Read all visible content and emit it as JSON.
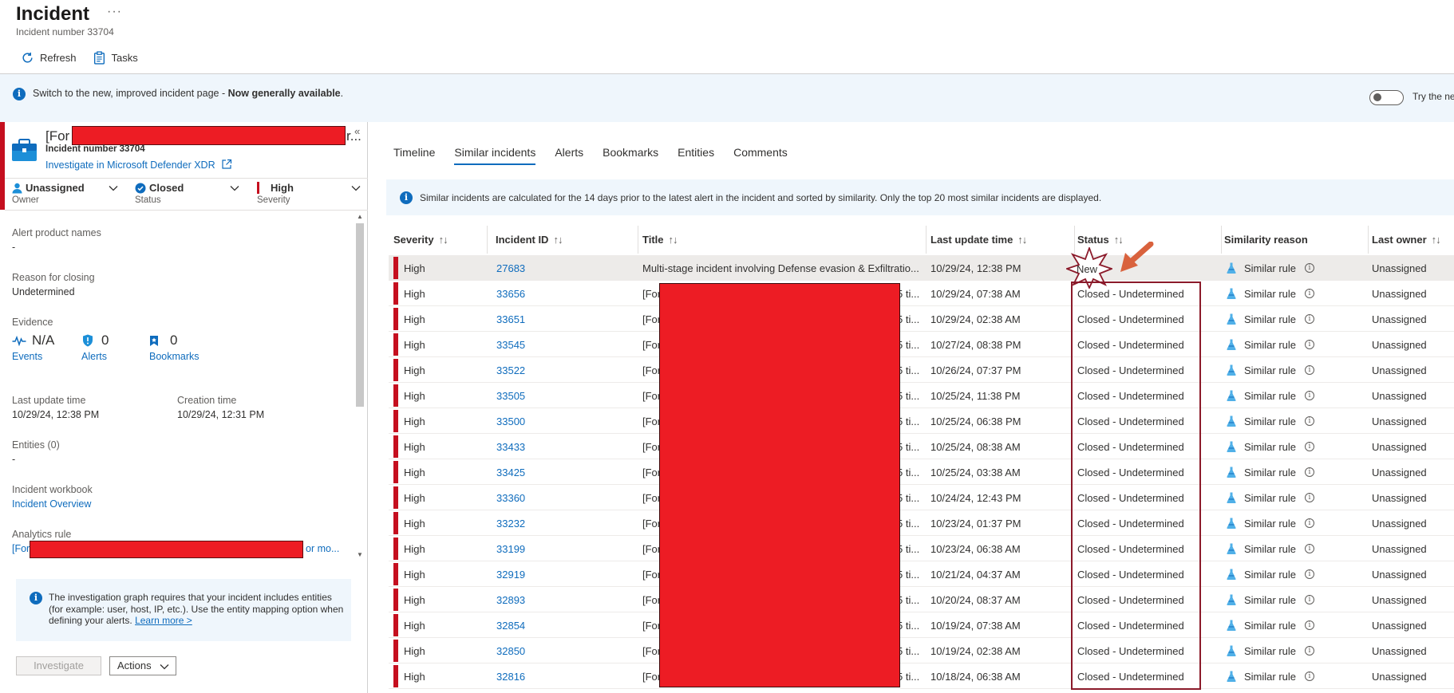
{
  "header": {
    "title": "Incident",
    "more": "···",
    "subtitle": "Incident number 33704"
  },
  "toolbar": {
    "refresh_label": "Refresh",
    "tasks_label": "Tasks"
  },
  "banner": {
    "text_plain": "Switch to the new, improved incident page - ",
    "text_bold": "Now generally available",
    "text_end": ".",
    "toggle_label": "Try the ne"
  },
  "left_panel": {
    "collapse": "«",
    "title_prefix": "[For",
    "title_suffix": "r...",
    "incident_number": "Incident number 33704",
    "investigate_link": "Investigate in Microsoft Defender XDR",
    "owner": {
      "value": "Unassigned",
      "label": "Owner"
    },
    "status": {
      "value": "Closed",
      "label": "Status"
    },
    "severity": {
      "value": "High",
      "label": "Severity"
    },
    "alert_product_names": {
      "label": "Alert product names",
      "value": "-"
    },
    "reason_for_closing": {
      "label": "Reason for closing",
      "value": "Undetermined"
    },
    "evidence": {
      "label": "Evidence",
      "events": {
        "num": "N/A",
        "label": "Events"
      },
      "alerts": {
        "num": "0",
        "label": "Alerts"
      },
      "bookmarks": {
        "num": "0",
        "label": "Bookmarks"
      }
    },
    "last_update_time": {
      "label": "Last update time",
      "value": "10/29/24, 12:38 PM"
    },
    "creation_time": {
      "label": "Creation time",
      "value": "10/29/24, 12:31 PM"
    },
    "entities": {
      "label": "Entities (0)",
      "value": "-"
    },
    "incident_workbook": {
      "label": "Incident workbook",
      "value": "Incident Overview"
    },
    "analytics_rule": {
      "label": "Analytics rule",
      "prefix": "[For",
      "more": "or mo..."
    },
    "graph_info": {
      "text": "The investigation graph requires that your incident includes entities (for example: user, host, IP, etc.). Use the entity mapping option when defining your alerts. ",
      "link": "Learn more >"
    },
    "investigate_button": "Investigate",
    "actions_button": "Actions"
  },
  "tabs": [
    {
      "label": "Timeline",
      "active": false
    },
    {
      "label": "Similar incidents",
      "active": true
    },
    {
      "label": "Alerts",
      "active": false
    },
    {
      "label": "Bookmarks",
      "active": false
    },
    {
      "label": "Entities",
      "active": false
    },
    {
      "label": "Comments",
      "active": false
    }
  ],
  "similar_info": "Similar incidents are calculated for the 14 days prior to the latest alert in the incident and sorted by similarity. Only the top 20 most similar incidents are displayed.",
  "table": {
    "sort_glyph": "↑↓",
    "columns": {
      "severity": "Severity",
      "incident_id": "Incident ID",
      "title": "Title",
      "last_update_time": "Last update time",
      "status": "Status",
      "similarity_reason": "Similarity reason",
      "last_owner": "Last owner"
    },
    "title_first_row": "Multi-stage incident involving Defense evasion & Exfiltratio...",
    "title_prefix": "[For",
    "title_tail": "5 ti...",
    "rows": [
      {
        "severity": "High",
        "id": "27683",
        "time": "10/29/24, 12:38 PM",
        "status": "New",
        "reason": "Similar rule",
        "owner": "Unassigned"
      },
      {
        "severity": "High",
        "id": "33656",
        "time": "10/29/24, 07:38 AM",
        "status": "Closed - Undetermined",
        "reason": "Similar rule",
        "owner": "Unassigned"
      },
      {
        "severity": "High",
        "id": "33651",
        "time": "10/29/24, 02:38 AM",
        "status": "Closed - Undetermined",
        "reason": "Similar rule",
        "owner": "Unassigned"
      },
      {
        "severity": "High",
        "id": "33545",
        "time": "10/27/24, 08:38 PM",
        "status": "Closed - Undetermined",
        "reason": "Similar rule",
        "owner": "Unassigned"
      },
      {
        "severity": "High",
        "id": "33522",
        "time": "10/26/24, 07:37 PM",
        "status": "Closed - Undetermined",
        "reason": "Similar rule",
        "owner": "Unassigned"
      },
      {
        "severity": "High",
        "id": "33505",
        "time": "10/25/24, 11:38 PM",
        "status": "Closed - Undetermined",
        "reason": "Similar rule",
        "owner": "Unassigned"
      },
      {
        "severity": "High",
        "id": "33500",
        "time": "10/25/24, 06:38 PM",
        "status": "Closed - Undetermined",
        "reason": "Similar rule",
        "owner": "Unassigned"
      },
      {
        "severity": "High",
        "id": "33433",
        "time": "10/25/24, 08:38 AM",
        "status": "Closed - Undetermined",
        "reason": "Similar rule",
        "owner": "Unassigned"
      },
      {
        "severity": "High",
        "id": "33425",
        "time": "10/25/24, 03:38 AM",
        "status": "Closed - Undetermined",
        "reason": "Similar rule",
        "owner": "Unassigned"
      },
      {
        "severity": "High",
        "id": "33360",
        "time": "10/24/24, 12:43 PM",
        "status": "Closed - Undetermined",
        "reason": "Similar rule",
        "owner": "Unassigned"
      },
      {
        "severity": "High",
        "id": "33232",
        "time": "10/23/24, 01:37 PM",
        "status": "Closed - Undetermined",
        "reason": "Similar rule",
        "owner": "Unassigned"
      },
      {
        "severity": "High",
        "id": "33199",
        "time": "10/23/24, 06:38 AM",
        "status": "Closed - Undetermined",
        "reason": "Similar rule",
        "owner": "Unassigned"
      },
      {
        "severity": "High",
        "id": "32919",
        "time": "10/21/24, 04:37 AM",
        "status": "Closed - Undetermined",
        "reason": "Similar rule",
        "owner": "Unassigned"
      },
      {
        "severity": "High",
        "id": "32893",
        "time": "10/20/24, 08:37 AM",
        "status": "Closed - Undetermined",
        "reason": "Similar rule",
        "owner": "Unassigned"
      },
      {
        "severity": "High",
        "id": "32854",
        "time": "10/19/24, 07:38 AM",
        "status": "Closed - Undetermined",
        "reason": "Similar rule",
        "owner": "Unassigned"
      },
      {
        "severity": "High",
        "id": "32850",
        "time": "10/19/24, 02:38 AM",
        "status": "Closed - Undetermined",
        "reason": "Similar rule",
        "owner": "Unassigned"
      },
      {
        "severity": "High",
        "id": "32816",
        "time": "10/18/24, 06:38 AM",
        "status": "Closed - Undetermined",
        "reason": "Similar rule",
        "owner": "Unassigned"
      }
    ]
  },
  "colors": {
    "accent": "#0f6cbd",
    "severity_high": "#c50f1f",
    "redaction": "#ed1c24",
    "annotation_box": "#8b1a2a",
    "annotation_arrow": "#d9623d"
  }
}
